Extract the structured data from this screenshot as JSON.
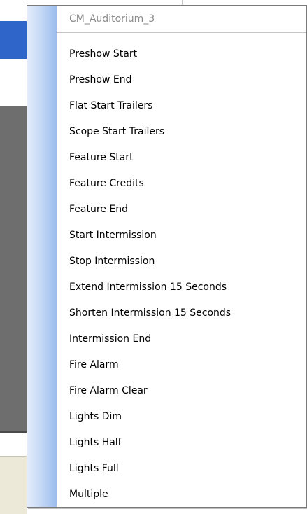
{
  "menu": {
    "header": "CM_Auditorium_3",
    "items": [
      "Preshow Start",
      "Preshow End",
      "Flat Start Trailers",
      "Scope Start Trailers",
      "Feature Start",
      "Feature Credits",
      "Feature End",
      "Start Intermission",
      "Stop Intermission",
      "Extend Intermission 15 Seconds",
      "Shorten Intermission 15 Seconds",
      "Intermission End",
      "Fire Alarm",
      "Fire Alarm Clear",
      "Lights Dim",
      "Lights Half",
      "Lights Full",
      "Multiple"
    ]
  },
  "colors": {
    "header_text": "#8a8a8a",
    "gutter_light": "#e3ecfb",
    "gutter_dark": "#9bbcec",
    "background_blue": "#2f64c9",
    "background_grey": "#6e6e6e",
    "background_beige": "#ece9d8"
  }
}
